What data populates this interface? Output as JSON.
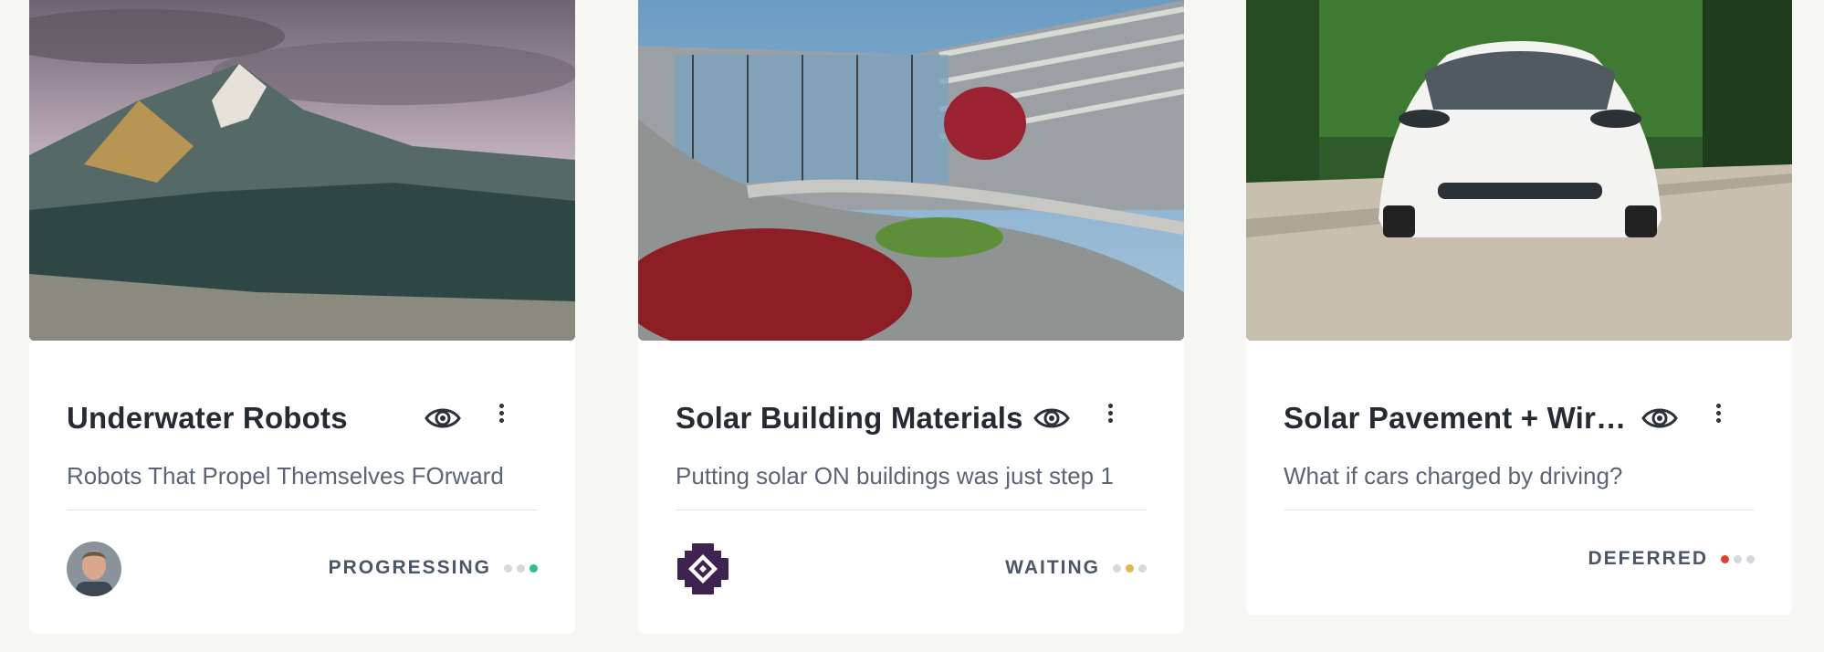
{
  "cards": [
    {
      "title": "Underwater Robots",
      "subtitle": "Robots That Propel Themselves FOrward",
      "status": "PROGRESSING",
      "status_color": "#2fbf86",
      "active_dot": 3,
      "owner": "person-avatar"
    },
    {
      "title": "Solar Building Materials",
      "subtitle": "Putting solar ON buildings was just step 1",
      "status": "WAITING",
      "status_color": "#e2b84a",
      "active_dot": 2,
      "owner": "purple-pattern-logo"
    },
    {
      "title": "Solar Pavement + Wirel...",
      "subtitle": "What if cars charged by driving?",
      "status": "DEFERRED",
      "status_color": "#d9442f",
      "active_dot": 1,
      "owner": null
    }
  ],
  "icons": {
    "watch": "eye-icon",
    "menu": "more-vertical-icon"
  }
}
